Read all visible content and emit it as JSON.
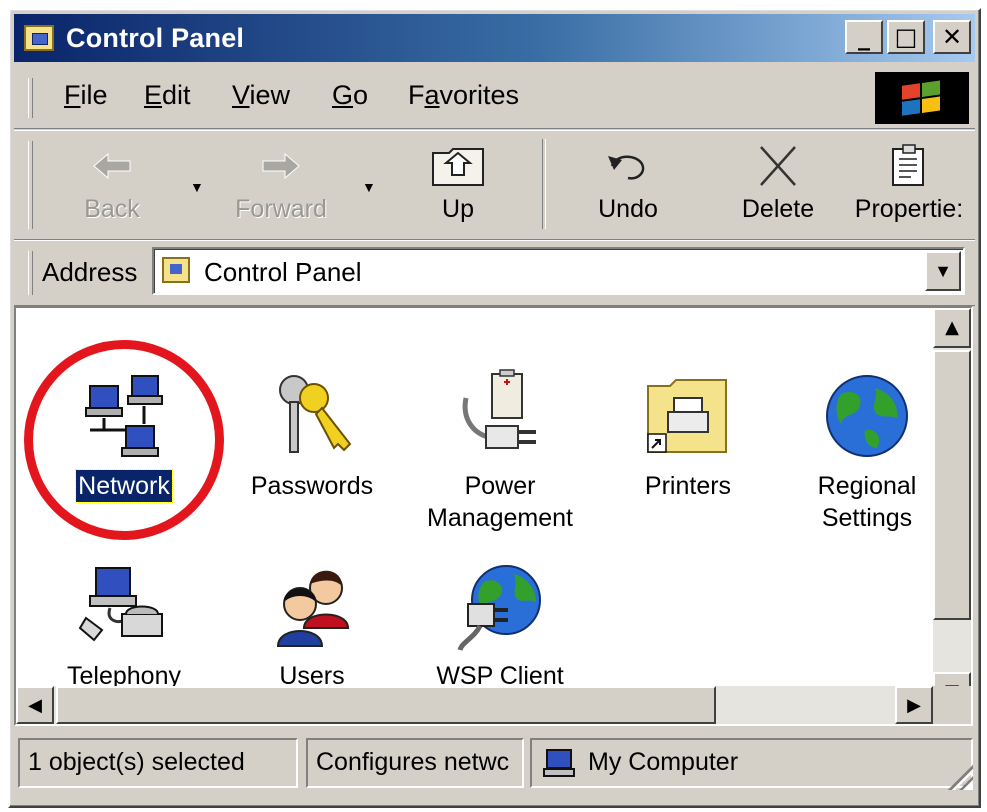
{
  "window": {
    "title": "Control Panel",
    "controls": {
      "minimize": "_",
      "maximize": "□",
      "close": "✕"
    }
  },
  "menu": {
    "items": [
      {
        "label": "File"
      },
      {
        "label": "Edit"
      },
      {
        "label": "View"
      },
      {
        "label": "Go"
      },
      {
        "label": "Favorites"
      }
    ]
  },
  "toolbar": {
    "back": {
      "label": "Back",
      "icon": "back-arrow-icon",
      "enabled": false
    },
    "forward": {
      "label": "Forward",
      "icon": "forward-arrow-icon",
      "enabled": false
    },
    "up": {
      "label": "Up",
      "icon": "up-folder-icon"
    },
    "undo": {
      "label": "Undo",
      "icon": "undo-icon"
    },
    "delete": {
      "label": "Delete",
      "icon": "delete-x-icon"
    },
    "properties": {
      "label": "Propertie:",
      "icon": "properties-icon"
    }
  },
  "address": {
    "label": "Address",
    "value": "Control Panel"
  },
  "items": [
    {
      "label": "Network",
      "icon": "network-icon",
      "selected": true
    },
    {
      "label": "Passwords",
      "icon": "keys-icon"
    },
    {
      "label": "Power Management",
      "icon": "power-plug-icon"
    },
    {
      "label": "Printers",
      "icon": "printer-folder-icon"
    },
    {
      "label": "Regional Settings",
      "icon": "globe-icon"
    },
    {
      "label": "Telephony",
      "icon": "telephony-icon"
    },
    {
      "label": "Users",
      "icon": "users-icon"
    },
    {
      "label": "WSP Client",
      "icon": "wsp-client-icon"
    }
  ],
  "status": {
    "selection": "1 object(s) selected",
    "description": "Configures netwc",
    "zone": "My Computer"
  },
  "colors": {
    "title_bar": "#0a246a",
    "selection": "#0a246a",
    "highlight_circle": "#e3161d",
    "face": "#d4d0c8"
  }
}
